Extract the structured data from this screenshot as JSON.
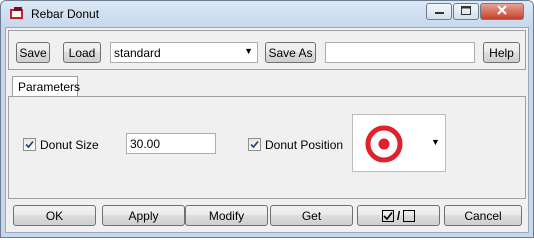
{
  "window": {
    "title": "Rebar Donut"
  },
  "toolbar": {
    "save_label": "Save",
    "load_label": "Load",
    "preset_value": "standard",
    "save_as_label": "Save As",
    "save_as_name_value": "",
    "help_label": "Help"
  },
  "tabs": [
    {
      "label": "Parameters"
    }
  ],
  "parameters": {
    "donut_size": {
      "label": "Donut Size",
      "checked": true,
      "value": "30.00"
    },
    "donut_position": {
      "label": "Donut Position",
      "checked": true
    }
  },
  "footer": {
    "ok_label": "OK",
    "apply_label": "Apply",
    "modify_label": "Modify",
    "get_label": "Get",
    "toggle_separator": "/",
    "cancel_label": "Cancel"
  },
  "icons": {
    "app": "rebar-app-icon",
    "minimize": "minimize-icon",
    "maximize": "maximize-icon",
    "close": "close-icon",
    "dropdown": "chevron-down-icon",
    "target": "target-icon"
  },
  "colors": {
    "accent": "#e0202a"
  }
}
